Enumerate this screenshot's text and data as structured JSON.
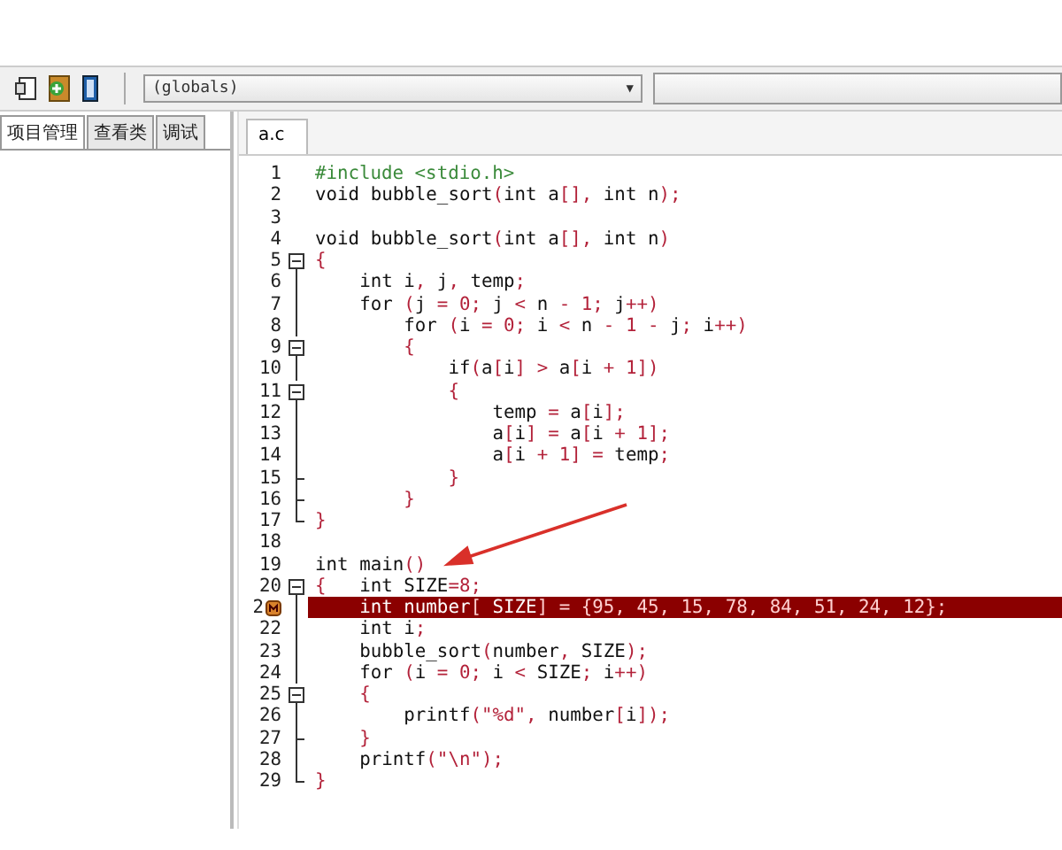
{
  "toolbar": {
    "scope_dropdown": "(globals)",
    "scope_dropdown_arrow": "▼"
  },
  "side_tabs": [
    {
      "label": "项目管理",
      "selected": true
    },
    {
      "label": "查看类",
      "selected": false
    },
    {
      "label": "调试",
      "selected": false
    }
  ],
  "editor_tabs": [
    {
      "label": "a.c",
      "selected": true
    }
  ],
  "lines": [
    {
      "number": "1",
      "kind": "preprocessor",
      "code": "#include <stdio.h>"
    },
    {
      "number": "2",
      "kind": "code",
      "code": "void bubble_sort(int a[], int n);"
    },
    {
      "number": "3"
    },
    {
      "number": "4",
      "kind": "code",
      "code": "void bubble_sort(int a[], int n)"
    },
    {
      "number": "5",
      "kind": "code",
      "fold": {
        "kind": "start"
      },
      "code": "{"
    },
    {
      "number": "6",
      "kind": "code",
      "fold": {
        "kind": "line"
      },
      "code": "    int i, j, temp;"
    },
    {
      "number": "7",
      "kind": "code",
      "fold": {
        "kind": "line"
      },
      "code": "    for (j = 0; j < n - 1; j++)"
    },
    {
      "number": "8",
      "kind": "code",
      "fold": {
        "kind": "line"
      },
      "code": "        for (i = 0; i < n - 1 - j; i++)"
    },
    {
      "number": "9",
      "kind": "code",
      "fold": {
        "kind": "start"
      },
      "code": "        {"
    },
    {
      "number": "10",
      "kind": "code",
      "fold": {
        "kind": "line"
      },
      "code": "            if(a[i] > a[i + 1])"
    },
    {
      "number": "11",
      "kind": "code",
      "fold": {
        "kind": "start"
      },
      "code": "            {"
    },
    {
      "number": "12",
      "kind": "code",
      "fold": {
        "kind": "line"
      },
      "code": "                temp = a[i];"
    },
    {
      "number": "13",
      "kind": "code",
      "fold": {
        "kind": "line"
      },
      "code": "                a[i] = a[i + 1];"
    },
    {
      "number": "14",
      "kind": "code",
      "fold": {
        "kind": "line"
      },
      "code": "                a[i + 1] = temp;"
    },
    {
      "number": "15",
      "kind": "code",
      "fold": {
        "kind": "tick"
      },
      "code": "            }"
    },
    {
      "number": "16",
      "kind": "code",
      "fold": {
        "kind": "tick"
      },
      "code": "        }"
    },
    {
      "number": "17",
      "kind": "code",
      "fold": {
        "kind": "end"
      },
      "code": "}"
    },
    {
      "number": "18"
    },
    {
      "number": "19",
      "kind": "code",
      "code": "int main()"
    },
    {
      "number": "20",
      "kind": "code",
      "fold": {
        "kind": "start"
      },
      "code": "{   int SIZE=8;"
    },
    {
      "number": "2",
      "kind": "code",
      "fold": {
        "kind": "line"
      },
      "breakpoint": true,
      "highlighted": true,
      "code": "    int number[ SIZE] = {95, 45, 15, 78, 84, 51, 24, 12};"
    },
    {
      "number": "22",
      "kind": "code",
      "fold": {
        "kind": "line"
      },
      "code": "    int i;"
    },
    {
      "number": "23",
      "kind": "code",
      "fold": {
        "kind": "line"
      },
      "code": "    bubble_sort(number, SIZE);"
    },
    {
      "number": "24",
      "kind": "code",
      "fold": {
        "kind": "line"
      },
      "code": "    for (i = 0; i < SIZE; i++)"
    },
    {
      "number": "25",
      "kind": "code",
      "fold": {
        "kind": "start"
      },
      "code": "    {"
    },
    {
      "number": "26",
      "kind": "code",
      "fold": {
        "kind": "line"
      },
      "code": "        printf(\"%d\", number[i]);"
    },
    {
      "number": "27",
      "kind": "code",
      "fold": {
        "kind": "tick"
      },
      "code": "    }"
    },
    {
      "number": "28",
      "kind": "code",
      "fold": {
        "kind": "line"
      },
      "code": "    printf(\"\\n\");"
    },
    {
      "number": "29",
      "kind": "code",
      "fold": {
        "kind": "end"
      },
      "code": "}"
    }
  ]
}
